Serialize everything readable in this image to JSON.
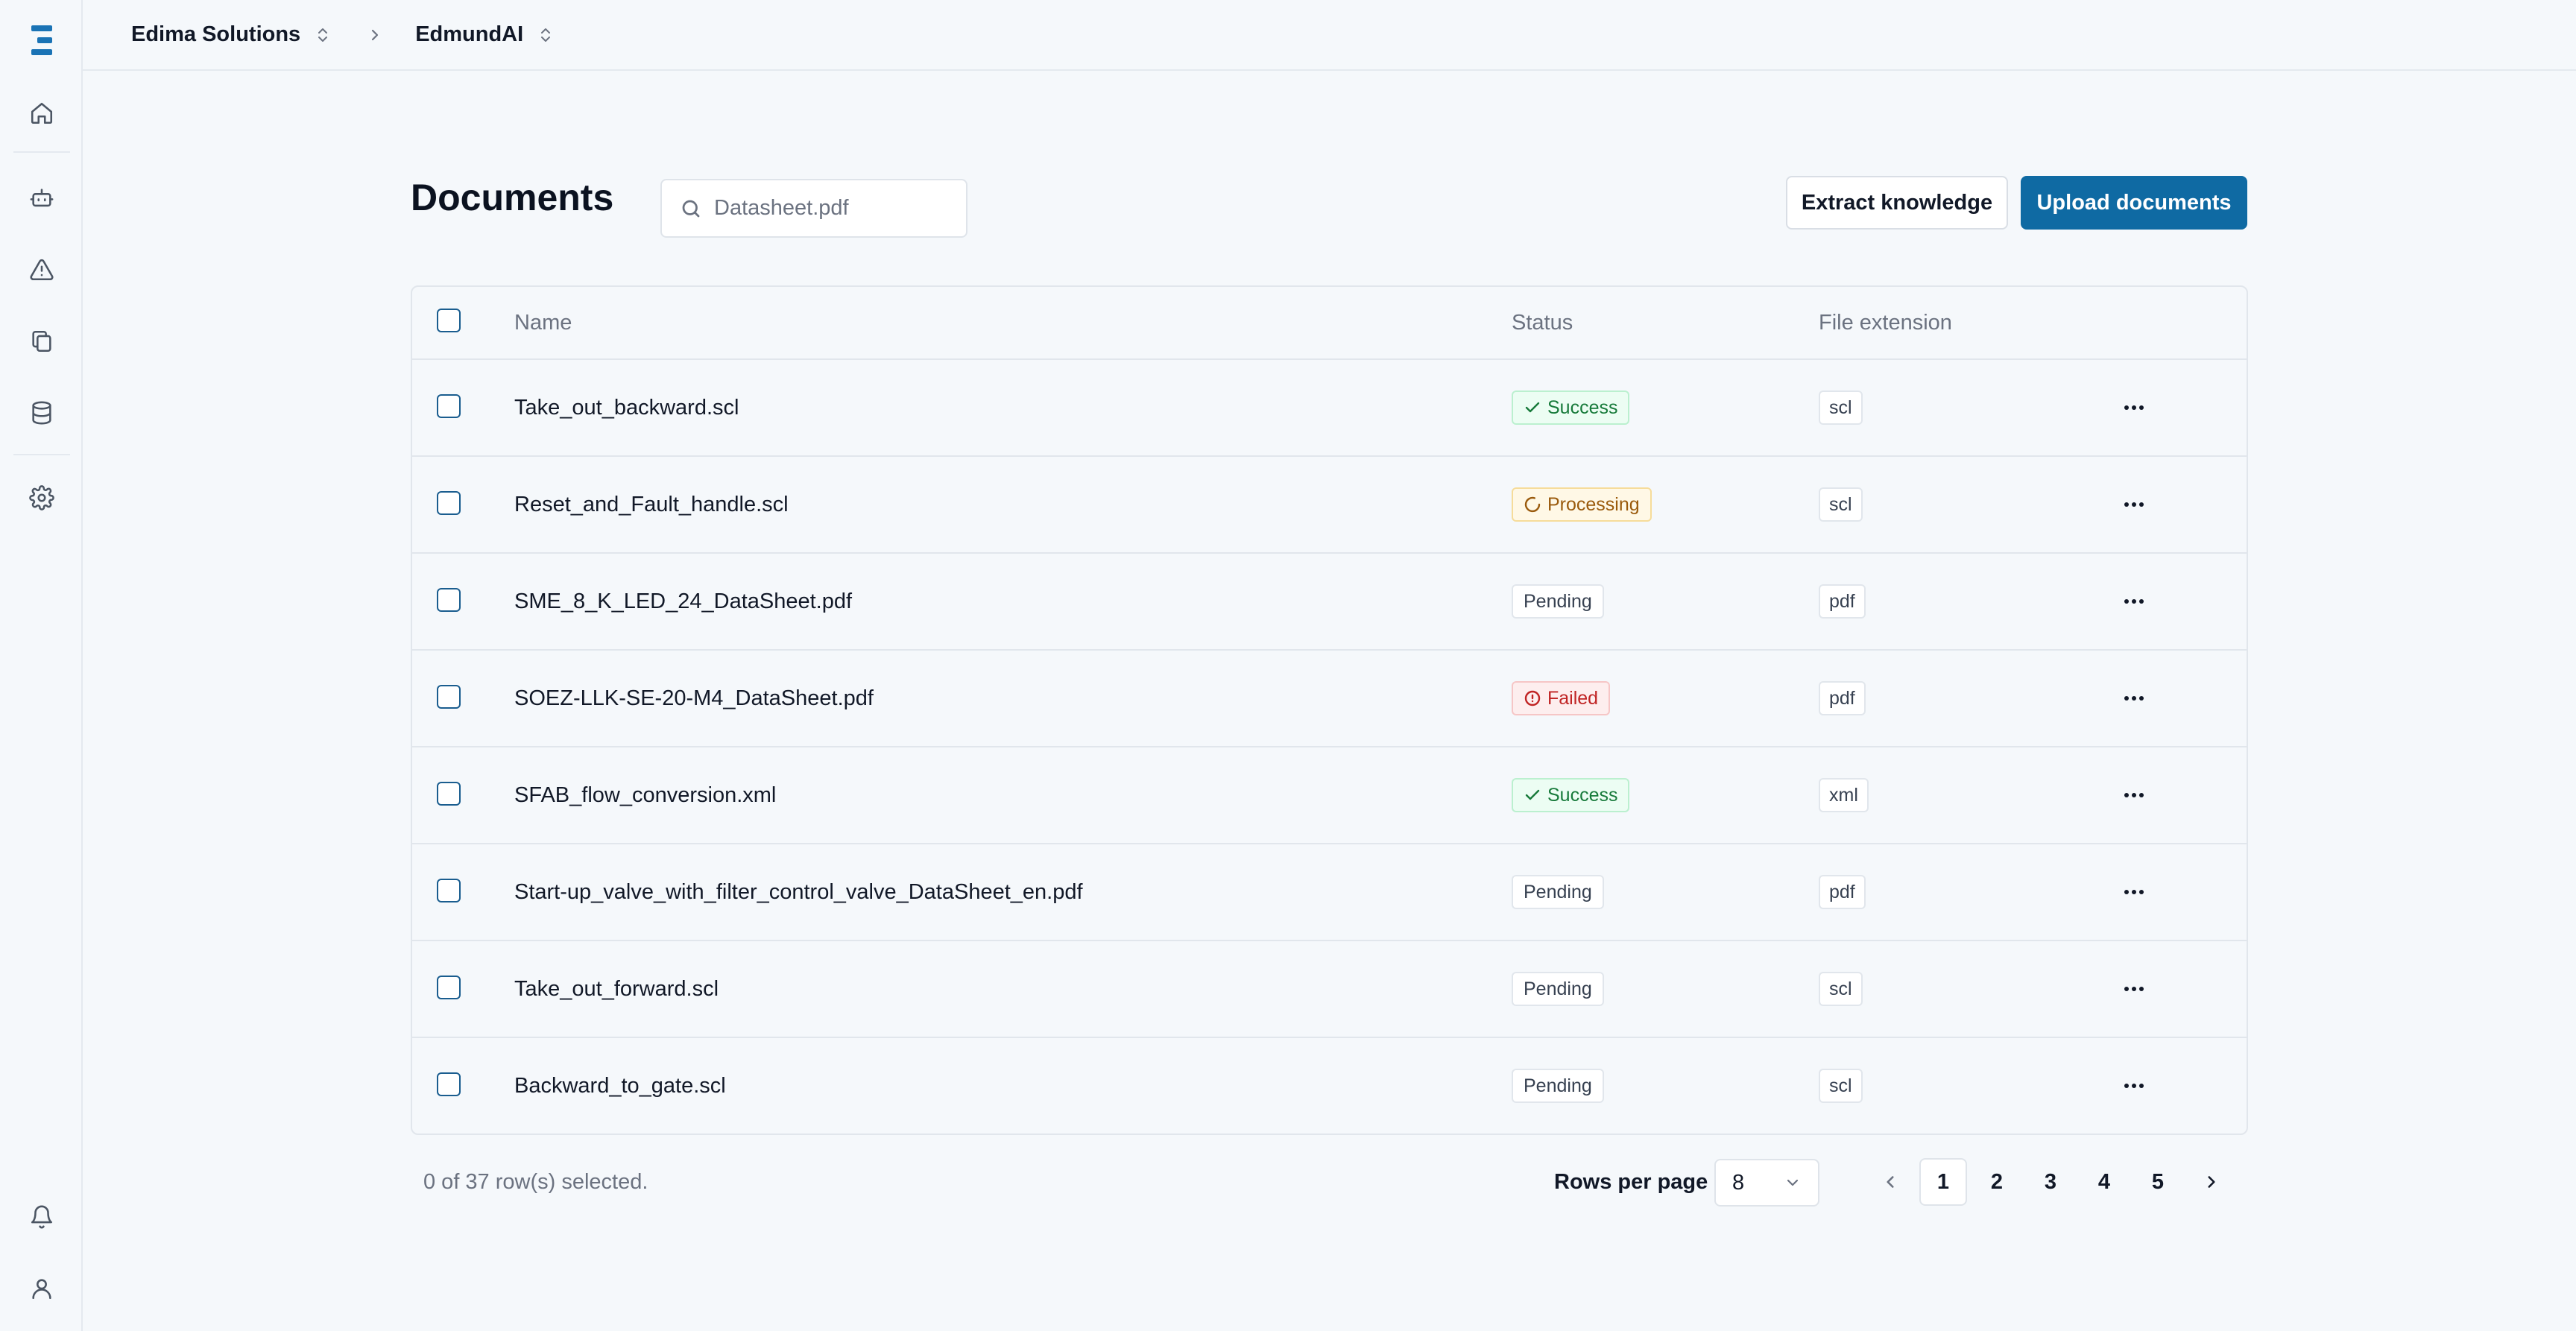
{
  "breadcrumb": {
    "org": "Edima Solutions",
    "project": "EdmundAI"
  },
  "sidebar": {
    "items": [
      {
        "icon": "home-icon"
      },
      {
        "icon": "bot-icon"
      },
      {
        "icon": "alert-triangle-icon"
      },
      {
        "icon": "documents-icon"
      },
      {
        "icon": "database-icon"
      },
      {
        "icon": "settings-icon"
      }
    ],
    "bottom": [
      {
        "icon": "bell-icon"
      },
      {
        "icon": "user-icon"
      }
    ]
  },
  "page": {
    "title": "Documents",
    "search_placeholder": "Datasheet.pdf",
    "extract_label": "Extract knowledge",
    "upload_label": "Upload documents"
  },
  "table": {
    "columns": [
      "Name",
      "Status",
      "File extension"
    ],
    "rows": [
      {
        "name": "Take_out_backward.scl",
        "status": "Success",
        "status_type": "success",
        "ext": "scl"
      },
      {
        "name": "Reset_and_Fault_handle.scl",
        "status": "Processing",
        "status_type": "processing",
        "ext": "scl"
      },
      {
        "name": "SME_8_K_LED_24_DataSheet.pdf",
        "status": "Pending",
        "status_type": "pending",
        "ext": "pdf"
      },
      {
        "name": "SOEZ-LLK-SE-20-M4_DataSheet.pdf",
        "status": "Failed",
        "status_type": "failed",
        "ext": "pdf"
      },
      {
        "name": "SFAB_flow_conversion.xml",
        "status": "Success",
        "status_type": "success",
        "ext": "xml"
      },
      {
        "name": "Start-up_valve_with_filter_control_valve_DataSheet_en.pdf",
        "status": "Pending",
        "status_type": "pending",
        "ext": "pdf"
      },
      {
        "name": "Take_out_forward.scl",
        "status": "Pending",
        "status_type": "pending",
        "ext": "scl"
      },
      {
        "name": "Backward_to_gate.scl",
        "status": "Pending",
        "status_type": "pending",
        "ext": "scl"
      }
    ]
  },
  "footer": {
    "selection_text": "0 of 37 row(s) selected.",
    "rows_per_page_label": "Rows per page",
    "rows_per_page_value": "8",
    "pages": [
      "1",
      "2",
      "3",
      "4",
      "5"
    ],
    "current_page": "1"
  },
  "colors": {
    "primary": "#0f6aa3",
    "success": "#177a3a",
    "processing": "#9a5a0c",
    "failed": "#c02424",
    "background": "#f5f8fb"
  }
}
